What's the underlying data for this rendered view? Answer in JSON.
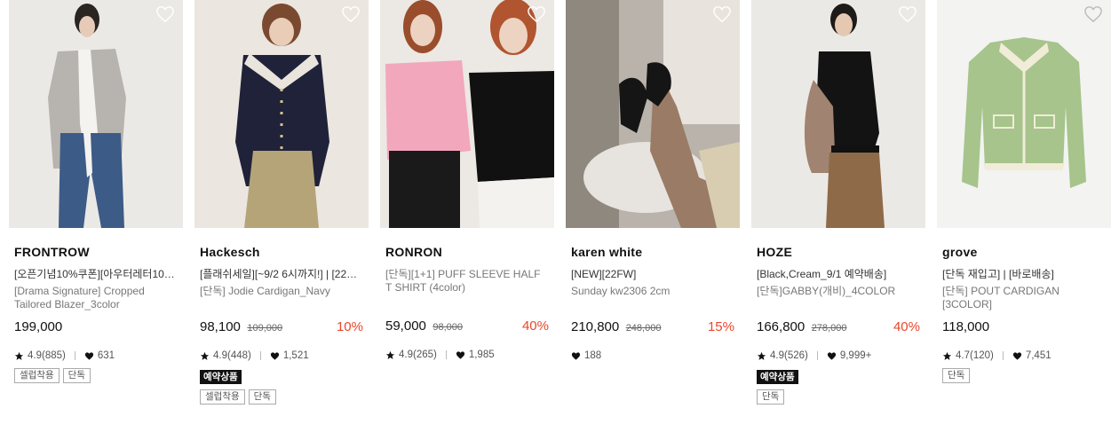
{
  "products": [
    {
      "brand": "FRONTROW",
      "promo": "[오픈기념10%쿠폰][아우터레터10…",
      "name": "[Drama Signature] Cropped Tailored Blazer_3color",
      "price": "199,000",
      "original_price": "",
      "discount": "",
      "rating": "4.9(885)",
      "likes": "631",
      "preorder": "",
      "tags": [
        "셀럽착용",
        "단독"
      ]
    },
    {
      "brand": "Hackesch",
      "promo": "[플래쉬세일][~9/2 6시까지!] | [22…",
      "name": "[단독] Jodie Cardigan_Navy",
      "price": "98,100",
      "original_price": "109,000",
      "discount": "10%",
      "rating": "4.9(448)",
      "likes": "1,521",
      "preorder": "예약상품",
      "tags": [
        "셀럽착용",
        "단독"
      ]
    },
    {
      "brand": "RONRON",
      "promo": "",
      "name": "[단독][1+1] PUFF SLEEVE HALF T SHIRT (4color)",
      "price": "59,000",
      "original_price": "98,000",
      "discount": "40%",
      "rating": "4.9(265)",
      "likes": "1,985",
      "preorder": "",
      "tags": []
    },
    {
      "brand": "karen white",
      "promo": "[NEW][22FW]",
      "name": "Sunday kw2306 2cm",
      "price": "210,800",
      "original_price": "248,000",
      "discount": "15%",
      "rating": "",
      "likes": "188",
      "preorder": "",
      "tags": []
    },
    {
      "brand": "HOZE",
      "promo": "[Black,Cream_9/1 예약배송]",
      "name": "[단독]GABBY(개비)_4COLOR",
      "price": "166,800",
      "original_price": "278,000",
      "discount": "40%",
      "rating": "4.9(526)",
      "likes": "9,999+",
      "preorder": "예약상품",
      "tags": [
        "단독"
      ]
    },
    {
      "brand": "grove",
      "promo": "[단독 재입고] | [바로배송]",
      "name": "[단독] POUT CARDIGAN [3COLOR]",
      "price": "118,000",
      "original_price": "",
      "discount": "",
      "rating": "4.7(120)",
      "likes": "7,451",
      "preorder": "",
      "tags": [
        "단독"
      ]
    }
  ],
  "colors": {
    "discount": "#e9462a",
    "preorder_bg": "#111111"
  }
}
